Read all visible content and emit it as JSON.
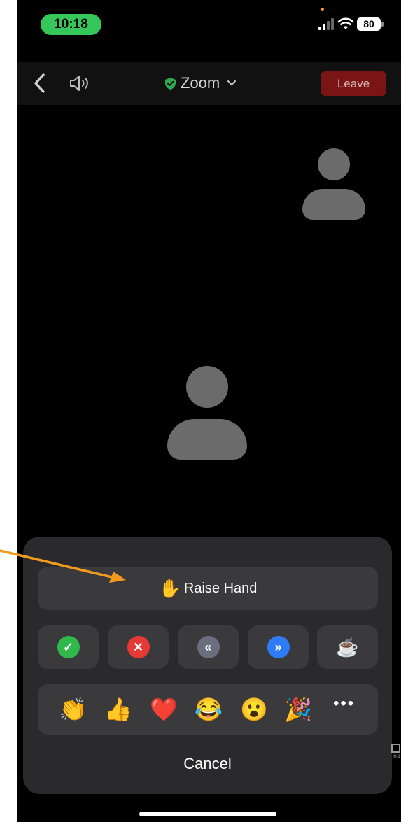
{
  "status_bar": {
    "time": "10:18",
    "battery": "80"
  },
  "header": {
    "title": "Zoom",
    "leave_label": "Leave"
  },
  "sheet": {
    "raise_hand": {
      "emoji": "✋",
      "label": "Raise Hand"
    },
    "quick_actions": [
      {
        "name": "yes",
        "glyph": "✓",
        "color": "#30b84a"
      },
      {
        "name": "no",
        "glyph": "✕",
        "color": "#e53935"
      },
      {
        "name": "slow-down",
        "glyph": "«",
        "color": "#6a6f80"
      },
      {
        "name": "speed-up",
        "glyph": "»",
        "color": "#2f7bf5"
      },
      {
        "name": "coffee-break",
        "glyph": "☕",
        "color": "#ffffff"
      }
    ],
    "reactions": [
      "👏",
      "👍",
      "❤️",
      "😂",
      "😮",
      "🎉"
    ],
    "more_label": "•••",
    "cancel_label": "Cancel"
  },
  "colors": {
    "accent_green": "#35c759",
    "leave_red": "#7a1515",
    "arrow_orange": "#f39a1e"
  }
}
